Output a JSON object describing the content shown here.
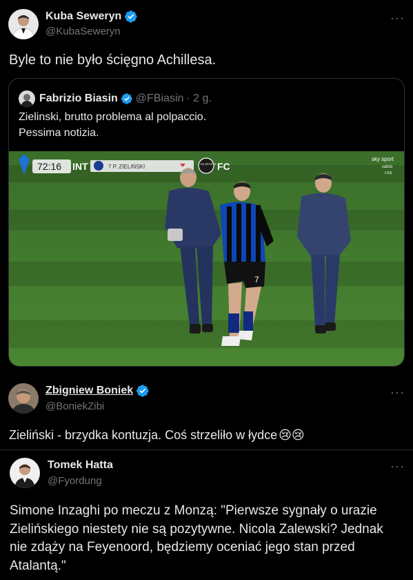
{
  "tweets": [
    {
      "author_name": "Kuba Seweryn",
      "author_handle": "@KubaSeweryn",
      "verified": true,
      "text": "Byle to nie było ścięgno Achillesa.",
      "quote": {
        "author_name": "Fabrizio Biasin",
        "author_handle": "@FBiasin",
        "time": "· 2 g.",
        "verified": true,
        "text_line1": "Zielinski, brutto problema al polpaccio.",
        "text_line2": "Pessima notizia.",
        "scoreboard": {
          "clock": "72:16",
          "team": "INT",
          "player": "7 P. ZIELIŃSKI",
          "badge": "EA SPORTS",
          "fc": "FC",
          "broadcaster": "sky sport",
          "channel": "calcio",
          "live": "LIVE"
        },
        "jersey_number": "7"
      }
    },
    {
      "author_name": "Zbigniew Boniek",
      "author_handle": "@BoniekZibi",
      "verified": true,
      "text": "Zieliński - brzydka kontuzja. Coś strzeliło w łydce",
      "emoji": "😢😢"
    },
    {
      "author_name": "Tomek Hatta",
      "author_handle": "@Fyordung",
      "verified": false,
      "text": "Simone Inzaghi po meczu z Monzą: \"Pierwsze sygnały o urazie Zielińskiego niestety nie są pozytywne. Nicola Zalewski? Jednak nie zdąży na Feyenoord, będziemy oceniać jego stan przed Atalantą.\""
    }
  ],
  "more_icon": "···",
  "colors": {
    "background": "#000000",
    "text": "#e7e9ea",
    "secondary": "#71767b",
    "verified": "#1d9bf0",
    "border": "#2f3336",
    "pitch": "#3f7a2c"
  }
}
